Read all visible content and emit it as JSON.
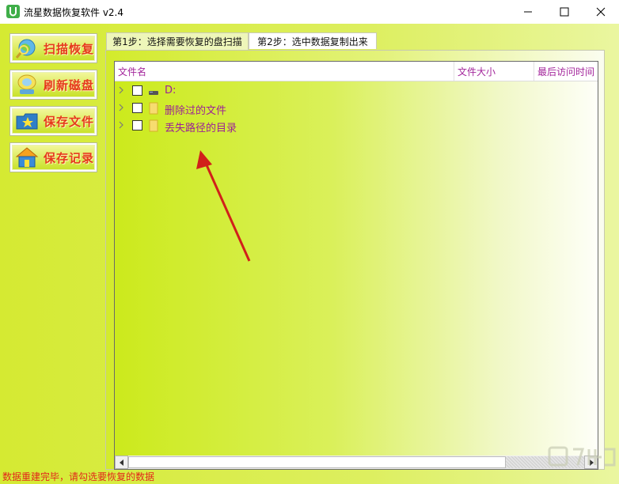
{
  "window": {
    "title": "流星数据恢复软件 v2.4"
  },
  "sidebar": {
    "buttons": [
      {
        "label": "扫描恢复",
        "icon": "magnifier-globe-icon"
      },
      {
        "label": "刷新磁盘",
        "icon": "refresh-disk-icon"
      },
      {
        "label": "保存文件",
        "icon": "folder-star-icon"
      },
      {
        "label": "保存记录",
        "icon": "house-icon"
      }
    ]
  },
  "tabs": [
    {
      "label": "第1步：选择需要恢复的盘扫描",
      "active": true
    },
    {
      "label": "第2步：选中数据复制出来",
      "active": false
    }
  ],
  "listview": {
    "columns": [
      "文件名",
      "文件大小",
      "最后访问时间"
    ],
    "rows": [
      {
        "label": "D:",
        "icon": "drive-icon",
        "checked": false
      },
      {
        "label": "删除过的文件",
        "icon": "folder-icon",
        "checked": false
      },
      {
        "label": "丢失路径的目录",
        "icon": "folder-icon",
        "checked": false
      }
    ]
  },
  "statusbar": {
    "text": "数据重建完毕，请勾选要恢复的数据"
  },
  "colors": {
    "accent": "#d5ea32",
    "label_purple": "#9c2296",
    "button_text": "#e53a1c",
    "status_red": "#e2281b",
    "annotation_arrow": "#d1201a"
  }
}
